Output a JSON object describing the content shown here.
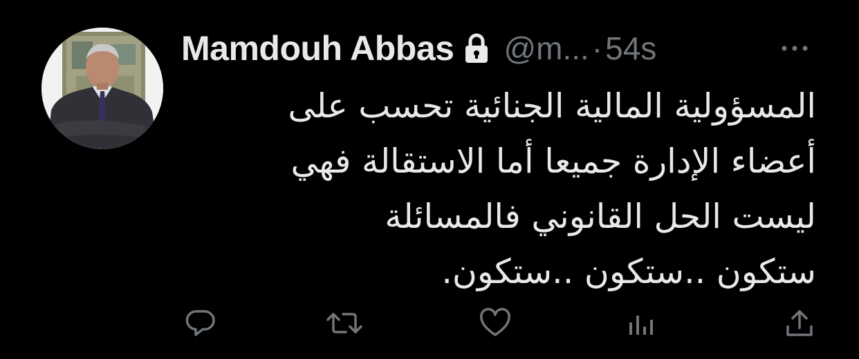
{
  "tweet": {
    "display_name": "Mamdouh Abbas",
    "handle": "@m...",
    "separator": "·",
    "time": "54s",
    "text_lines": [
      "المسؤولية المالية الجنائية تحسب على",
      "أعضاء الإدارة جميعا أما الاستقالة فهي",
      "ليست الحل القانوني فالمسائلة",
      "ستكون ..ستكون ..ستكون."
    ]
  },
  "icons": {
    "lock": "lock-icon",
    "more": "more-icon",
    "reply": "reply-icon",
    "retweet": "retweet-icon",
    "like": "like-icon",
    "views": "views-icon",
    "share": "share-icon"
  },
  "colors": {
    "background": "#000000",
    "primary_text": "#e7e9ea",
    "secondary_text": "#71767b"
  }
}
